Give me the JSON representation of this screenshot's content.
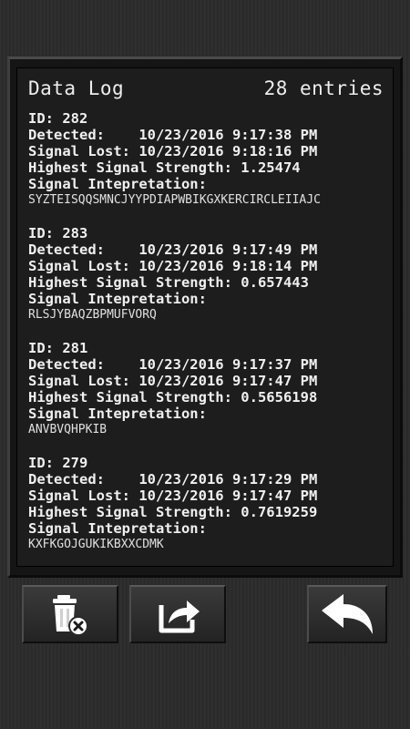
{
  "log": {
    "title": "Data Log",
    "count": "28 entries",
    "entries": [
      {
        "id": "ID: 282",
        "detected": "Detected:    10/23/2016 9:17:38 PM",
        "lost": "Signal Lost: 10/23/2016 9:18:16 PM",
        "strength": "Highest Signal Strength: 1.25474",
        "interp_label": "Signal Intepretation:",
        "interp_value": "SYZTEISQQSMNCJYYPDIAPWBIKGXKERCIRCLEIIAJC"
      },
      {
        "id": "ID: 283",
        "detected": "Detected:    10/23/2016 9:17:49 PM",
        "lost": "Signal Lost: 10/23/2016 9:18:14 PM",
        "strength": "Highest Signal Strength: 0.657443",
        "interp_label": "Signal Intepretation:",
        "interp_value": "RLSJYBAQZBPMUFVORQ"
      },
      {
        "id": "ID: 281",
        "detected": "Detected:    10/23/2016 9:17:37 PM",
        "lost": "Signal Lost: 10/23/2016 9:17:47 PM",
        "strength": "Highest Signal Strength: 0.5656198",
        "interp_label": "Signal Intepretation:",
        "interp_value": "ANVBVQHPKIB"
      },
      {
        "id": "ID: 279",
        "detected": "Detected:    10/23/2016 9:17:29 PM",
        "lost": "Signal Lost: 10/23/2016 9:17:47 PM",
        "strength": "Highest Signal Strength: 0.7619259",
        "interp_label": "Signal Intepretation:",
        "interp_value": "KXFKGOJGUKIKBXXCDMK"
      }
    ]
  },
  "toolbar": {
    "delete_icon": "trash-delete-icon",
    "share_icon": "share-export-icon",
    "back_icon": "back-arrow-icon"
  }
}
